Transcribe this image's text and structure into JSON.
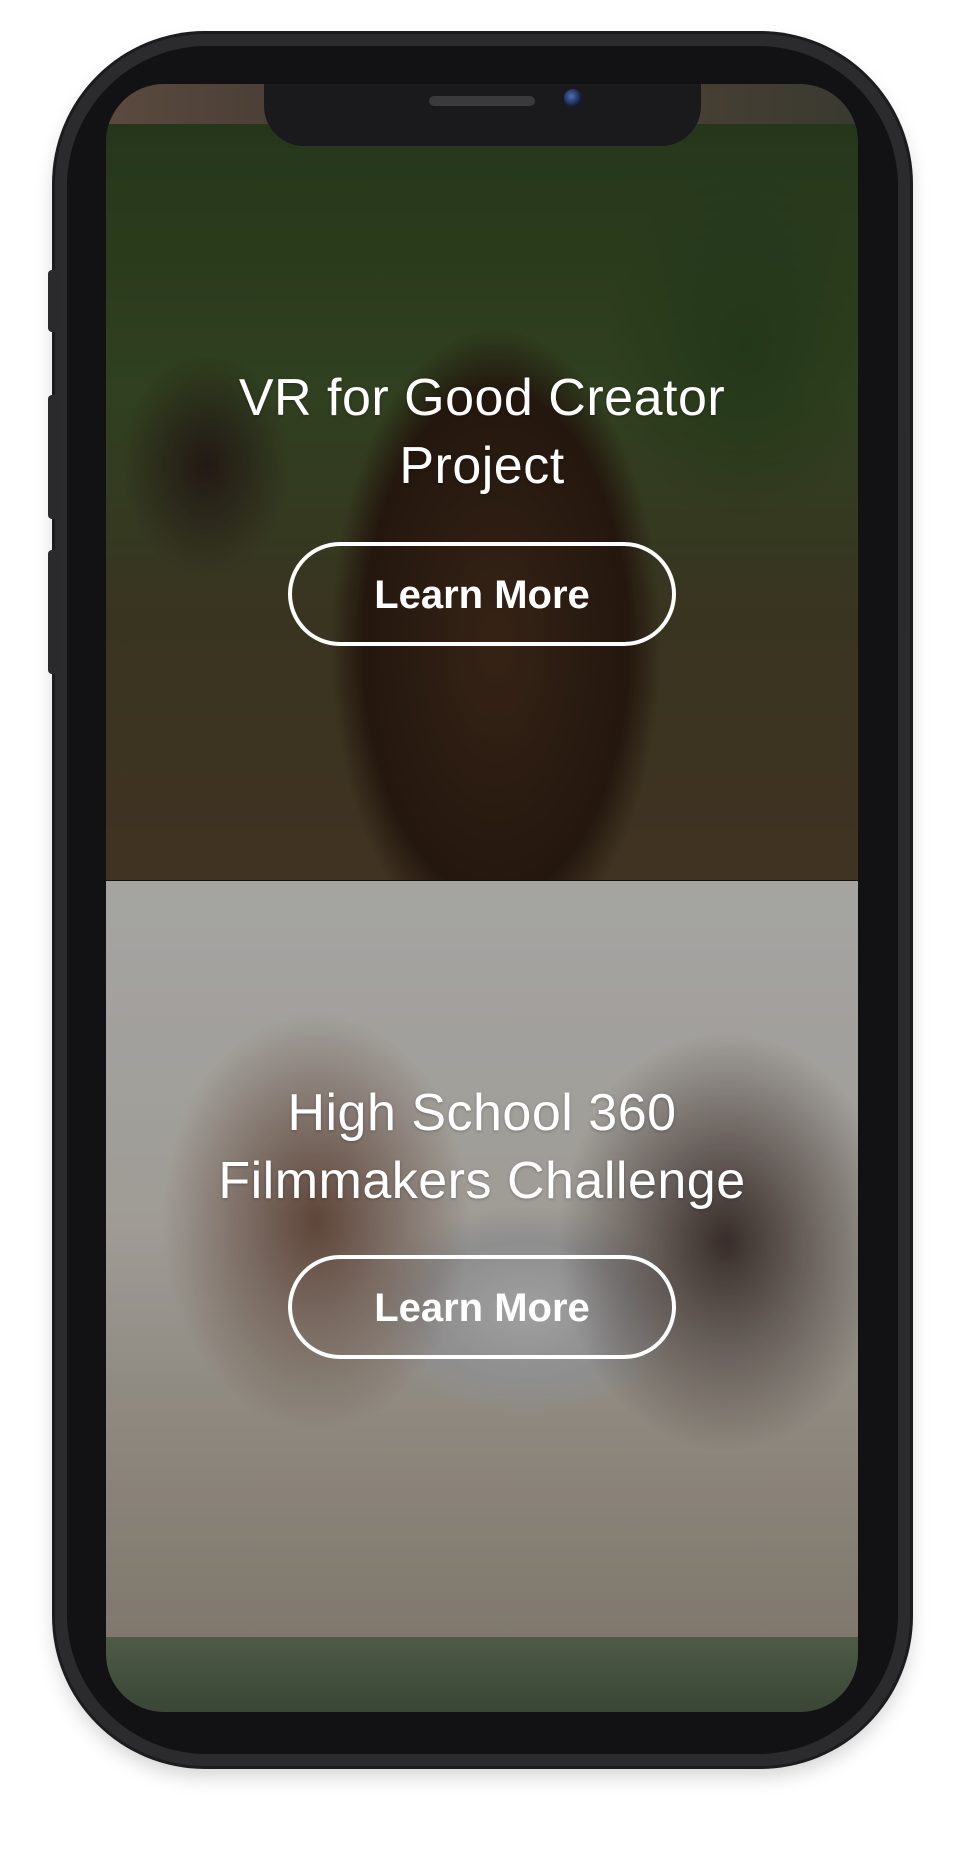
{
  "cards": [
    {
      "title": "VR for Good Creator Project",
      "button_label": "Learn More"
    },
    {
      "title": "High School 360 Filmmakers Challenge",
      "button_label": "Learn More"
    }
  ],
  "colors": {
    "button_border": "#ffffff",
    "text": "#ffffff",
    "device_frame": "#2b2b2d"
  },
  "icons": [
    "front-camera-icon",
    "speaker-grille-icon"
  ]
}
